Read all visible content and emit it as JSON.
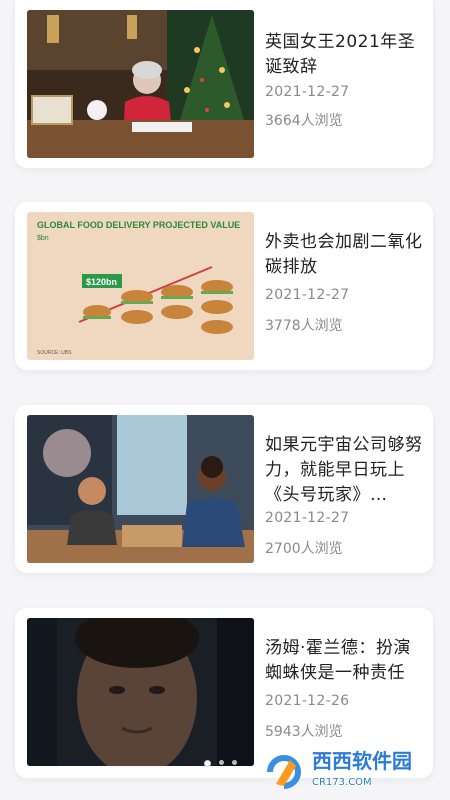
{
  "articles": [
    {
      "title": "英国女王2021年圣诞致辞",
      "date": "2021-12-27",
      "views": "3664人浏览"
    },
    {
      "title": "外卖也会加剧二氧化碳排放",
      "date": "2021-12-27",
      "views": "3778人浏览",
      "thumb_text": {
        "heading": "GLOBAL FOOD DELIVERY PROJECTED VALUE",
        "unit": "$bn",
        "badge": "$120bn"
      }
    },
    {
      "title": "如果元宇宙公司够努力，就能早日玩上《头号玩家》…",
      "date": "2021-12-27",
      "views": "2700人浏览"
    },
    {
      "title": "汤姆·霍兰德：扮演蜘蛛侠是一种责任",
      "date": "2021-12-26",
      "views": "5943人浏览"
    }
  ],
  "pager": {
    "count": 3,
    "active": 0
  },
  "watermark": {
    "brand": "西西软件园",
    "site": "CR173.COM"
  }
}
